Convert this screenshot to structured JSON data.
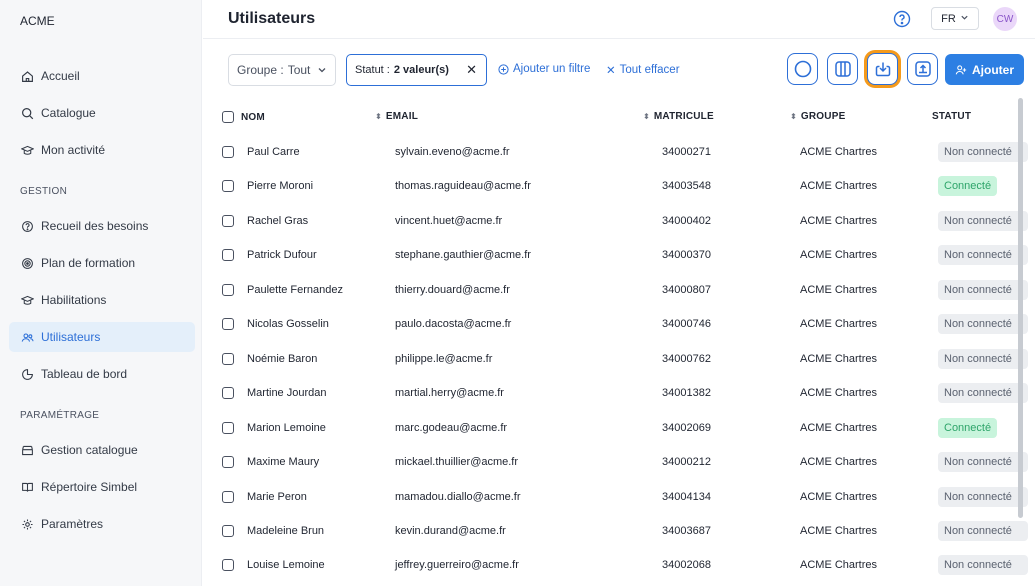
{
  "brand": "ACME",
  "sidebar": {
    "items": [
      {
        "label": "Accueil",
        "icon": "home-icon"
      },
      {
        "label": "Catalogue",
        "icon": "search-icon"
      },
      {
        "label": "Mon activité",
        "icon": "graduation-cap-icon"
      }
    ],
    "section_gestion": "GESTION",
    "gestion_items": [
      {
        "label": "Recueil des besoins",
        "icon": "help-circle-icon"
      },
      {
        "label": "Plan de formation",
        "icon": "target-icon"
      },
      {
        "label": "Habilitations",
        "icon": "graduation-cap-icon"
      },
      {
        "label": "Utilisateurs",
        "icon": "users-icon",
        "active": true
      },
      {
        "label": "Tableau de bord",
        "icon": "dashboard-icon"
      }
    ],
    "section_parametrage": "PARAMÉTRAGE",
    "parametrage_items": [
      {
        "label": "Gestion catalogue",
        "icon": "catalog-icon"
      },
      {
        "label": "Répertoire Simbel",
        "icon": "book-icon"
      },
      {
        "label": "Paramètres",
        "icon": "gear-icon"
      }
    ]
  },
  "header": {
    "title": "Utilisateurs",
    "lang": "FR",
    "avatar": "CW"
  },
  "filters": {
    "group_label": "Groupe :",
    "group_value": "Tout",
    "status_label": "Statut :",
    "status_value": "2 valeur(s)",
    "add_filter": "Ajouter un filtre",
    "clear_all": "Tout effacer"
  },
  "toolbar": {
    "add_label": "Ajouter"
  },
  "table": {
    "columns": {
      "name": "NOM",
      "email": "EMAIL",
      "matricule": "MATRICULE",
      "group": "GROUPE",
      "status": "STATUT"
    },
    "rows": [
      {
        "name": "Paul Carre",
        "email": "sylvain.eveno@acme.fr",
        "matricule": "34000271",
        "group": "ACME Chartres",
        "status": "Non connecté",
        "connected": false
      },
      {
        "name": "Pierre Moroni",
        "email": "thomas.raguideau@acme.fr",
        "matricule": "34003548",
        "group": "ACME Chartres",
        "status": "Connecté",
        "connected": true
      },
      {
        "name": "Rachel Gras",
        "email": "vincent.huet@acme.fr",
        "matricule": "34000402",
        "group": "ACME Chartres",
        "status": "Non connecté",
        "connected": false
      },
      {
        "name": "Patrick Dufour",
        "email": "stephane.gauthier@acme.fr",
        "matricule": "34000370",
        "group": "ACME Chartres",
        "status": "Non connecté",
        "connected": false
      },
      {
        "name": "Paulette Fernandez",
        "email": "thierry.douard@acme.fr",
        "matricule": "34000807",
        "group": "ACME Chartres",
        "status": "Non connecté",
        "connected": false
      },
      {
        "name": "Nicolas Gosselin",
        "email": "paulo.dacosta@acme.fr",
        "matricule": "34000746",
        "group": "ACME Chartres",
        "status": "Non connecté",
        "connected": false
      },
      {
        "name": "Noémie Baron",
        "email": "philippe.le@acme.fr",
        "matricule": "34000762",
        "group": "ACME Chartres",
        "status": "Non connecté",
        "connected": false
      },
      {
        "name": "Martine Jourdan",
        "email": "martial.herry@acme.fr",
        "matricule": "34001382",
        "group": "ACME Chartres",
        "status": "Non connecté",
        "connected": false
      },
      {
        "name": "Marion Lemoine",
        "email": "marc.godeau@acme.fr",
        "matricule": "34002069",
        "group": "ACME Chartres",
        "status": "Connecté",
        "connected": true
      },
      {
        "name": "Maxime Maury",
        "email": "mickael.thuillier@acme.fr",
        "matricule": "34000212",
        "group": "ACME Chartres",
        "status": "Non connecté",
        "connected": false
      },
      {
        "name": "Marie Peron",
        "email": "mamadou.diallo@acme.fr",
        "matricule": "34004134",
        "group": "ACME Chartres",
        "status": "Non connecté",
        "connected": false
      },
      {
        "name": "Madeleine Brun",
        "email": "kevin.durand@acme.fr",
        "matricule": "34003687",
        "group": "ACME Chartres",
        "status": "Non connecté",
        "connected": false
      },
      {
        "name": "Louise Lemoine",
        "email": "jeffrey.guerreiro@acme.fr",
        "matricule": "34002068",
        "group": "ACME Chartres",
        "status": "Non connecté",
        "connected": false
      }
    ]
  },
  "colors": {
    "accent": "#2d6fd7",
    "highlight": "#f59a1b",
    "connected_bg": "#c8f4dc",
    "connected_text": "#2ea56a"
  }
}
